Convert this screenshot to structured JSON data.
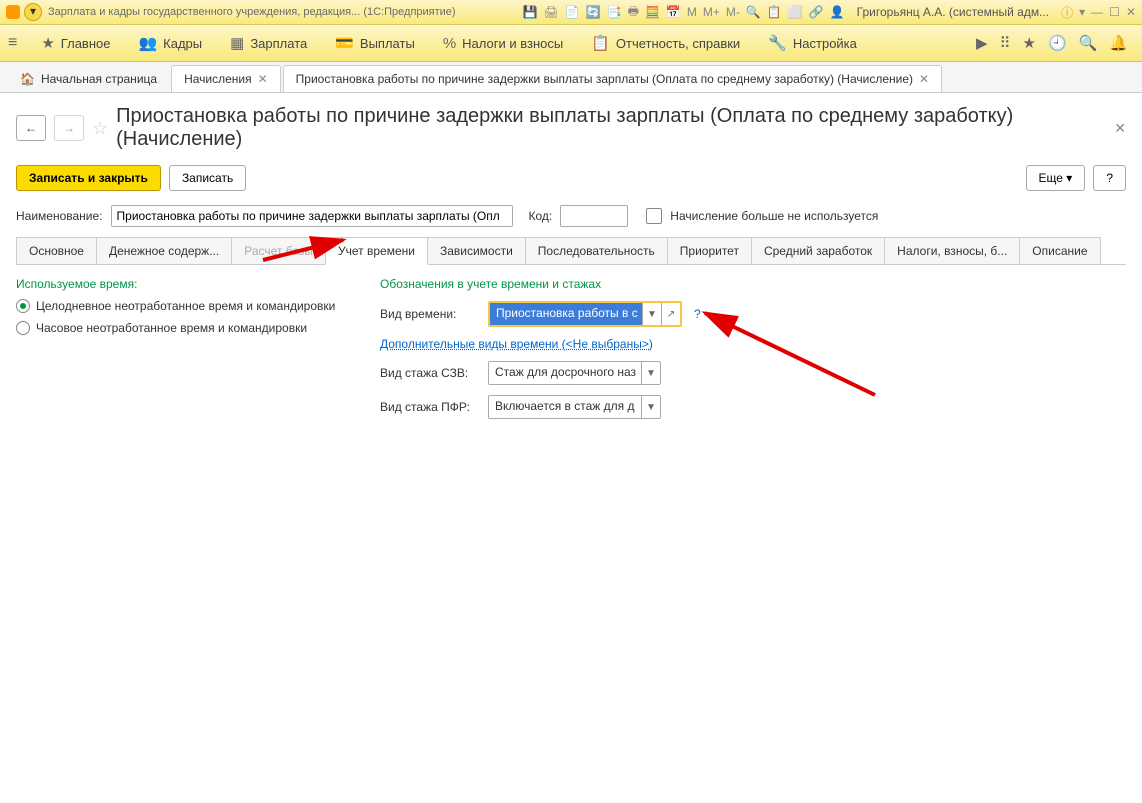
{
  "titlebar": {
    "title": "Зарплата и кадры государственного учреждения, редакция...  (1С:Предприятие)",
    "user": "Григорьянц А.А. (системный адм..."
  },
  "menubar": {
    "items": [
      {
        "icon": "≡",
        "label": "Главное"
      },
      {
        "icon": "👥",
        "label": "Кадры"
      },
      {
        "icon": "▦",
        "label": "Зарплата"
      },
      {
        "icon": "💳",
        "label": "Выплаты"
      },
      {
        "icon": "%",
        "label": "Налоги и взносы"
      },
      {
        "icon": "📋",
        "label": "Отчетность, справки"
      },
      {
        "icon": "🔧",
        "label": "Настройка"
      }
    ]
  },
  "tabs": {
    "home": "Начальная страница",
    "list": [
      {
        "label": "Начисления"
      },
      {
        "label": "Приостановка работы по причине задержки выплаты зарплаты (Оплата по среднему заработку) (Начисление)"
      }
    ]
  },
  "page": {
    "title": "Приостановка работы по причине задержки выплаты зарплаты (Оплата по среднему заработку) (Начисление)"
  },
  "toolbar": {
    "save_close": "Записать и закрыть",
    "save": "Записать",
    "more": "Еще"
  },
  "fields": {
    "name_label": "Наименование:",
    "name_value": "Приостановка работы по причине задержки выплаты зарплаты (Опл",
    "code_label": "Код:",
    "code_value": "",
    "not_used_label": "Начисление больше не используется"
  },
  "subtabs": [
    {
      "label": "Основное"
    },
    {
      "label": "Денежное содерж..."
    },
    {
      "label": "Расчет базы",
      "disabled": true
    },
    {
      "label": "Учет времени",
      "active": true
    },
    {
      "label": "Зависимости"
    },
    {
      "label": "Последовательность"
    },
    {
      "label": "Приоритет"
    },
    {
      "label": "Средний заработок"
    },
    {
      "label": "Налоги, взносы, б..."
    },
    {
      "label": "Описание"
    }
  ],
  "left": {
    "title": "Используемое время:",
    "options": [
      {
        "label": "Целодневное неотработанное время и командировки",
        "selected": true
      },
      {
        "label": "Часовое неотработанное время и командировки",
        "selected": false
      }
    ]
  },
  "right": {
    "title": "Обозначения в учете времени и стажах",
    "time_kind_label": "Вид времени:",
    "time_kind_value": "Приостановка работы в с",
    "extra_kinds_link": "Дополнительные виды времени (<Не выбраны>)",
    "szv_label": "Вид стажа СЗВ:",
    "szv_value": "Стаж для досрочного наз",
    "pfr_label": "Вид стажа ПФР:",
    "pfr_value": "Включается в стаж для д"
  }
}
